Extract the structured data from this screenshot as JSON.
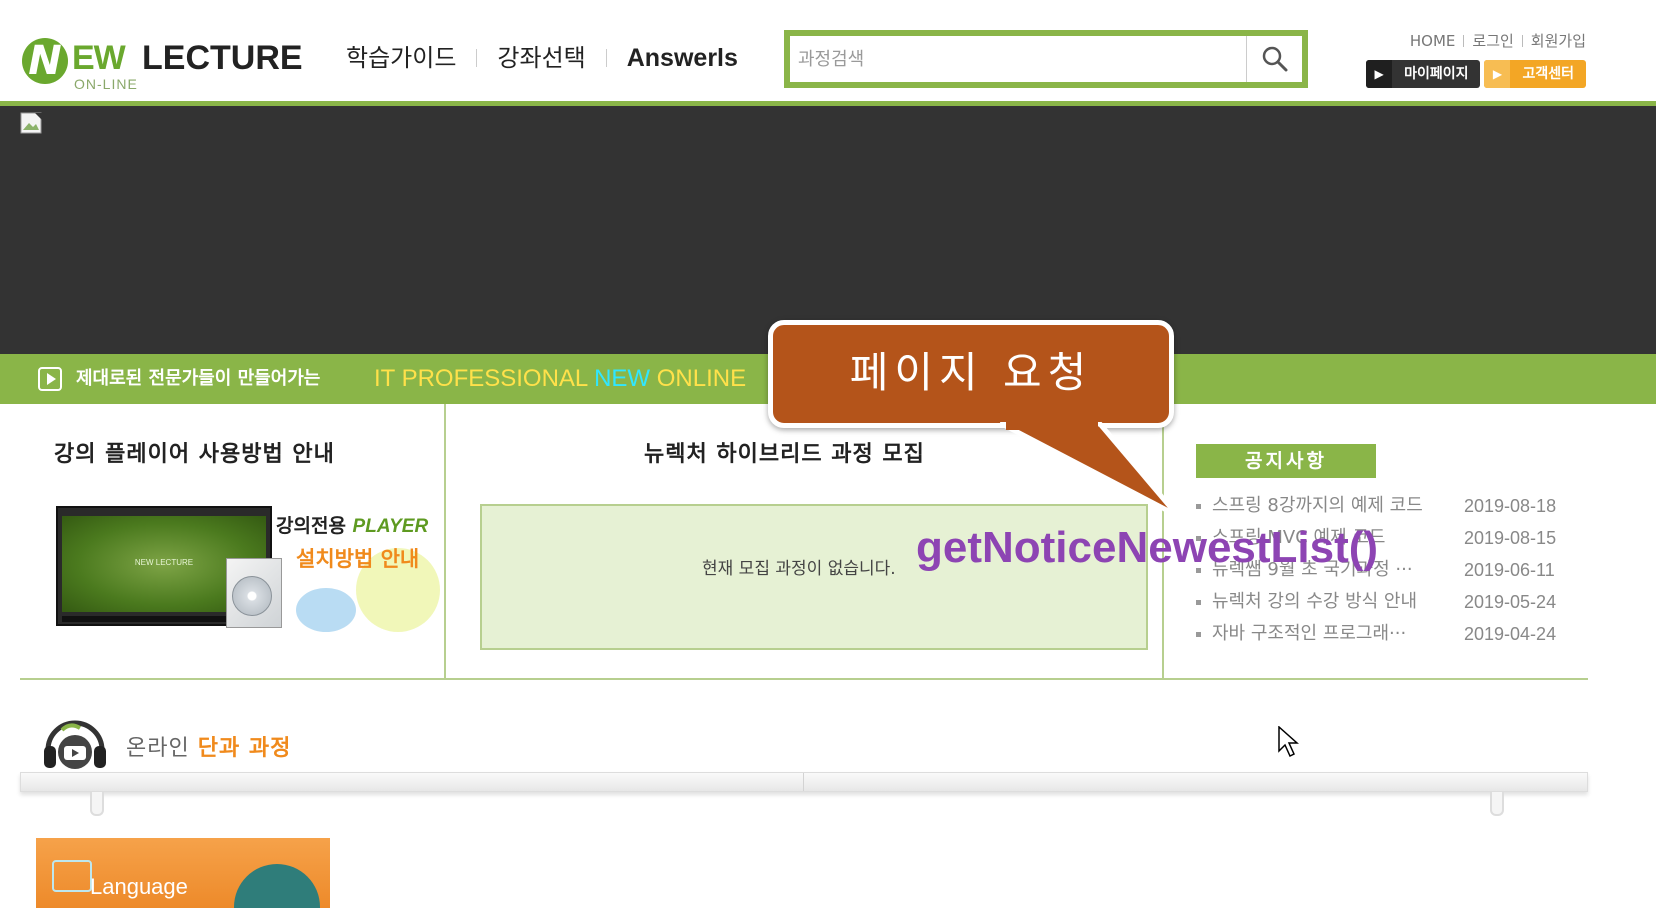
{
  "header": {
    "logo": {
      "initial": "N",
      "text_ew": "EW",
      "text_lecture": "LECTURE",
      "sub": "ON-LINE"
    },
    "nav": [
      {
        "label": "학습가이드"
      },
      {
        "label": "강좌선택"
      },
      {
        "label": "Answerls"
      }
    ],
    "search": {
      "placeholder": "과정검색"
    },
    "util_links": [
      {
        "label": "HOME"
      },
      {
        "label": "로그인"
      },
      {
        "label": "회원가입"
      }
    ],
    "mypage_label": "마이페이지",
    "customer_label": "고객센터"
  },
  "strip": {
    "kor_text": "제대로된 전문가들이 만들어가는",
    "eng_text_a": "IT PROFESSIONAL ",
    "eng_text_b": "NEW",
    "eng_text_c": " ONLINE"
  },
  "player_guide": {
    "title": "강의 플레이어 사용방법 안내",
    "screen_logo": "NEW LECTURE",
    "line1_a": "강의전용 ",
    "line1_b": "PLAYER",
    "line2": "설치방법 안내"
  },
  "recruit": {
    "title": "뉴렉처 하이브리드 과정 모집",
    "empty_message": "현재 모집 과정이 없습니다."
  },
  "notice": {
    "tab_label": "공지사항",
    "items": [
      {
        "title": "스프링 8강까지의 예제 코드",
        "date": "2019-08-18"
      },
      {
        "title": "스프링 MVC 예제 코드",
        "date": "2019-08-15"
      },
      {
        "title": "뉴렉쌤 9월 초 국기과정 ···",
        "date": "2019-06-11"
      },
      {
        "title": "뉴렉처 강의 수강 방식 안내",
        "date": "2019-05-24"
      },
      {
        "title": "자바 구조적인 프로그래···",
        "date": "2019-04-24"
      }
    ]
  },
  "online": {
    "title_a": "온라인 ",
    "title_b": "단과 과정",
    "course_card_label": "Language"
  },
  "overlay": {
    "callout_text": "페이지 요청",
    "function_label": "getNoticeNewestList()"
  },
  "colors": {
    "brand_green": "#8ab548",
    "accent_orange": "#f08a1c",
    "callout_brown": "#b4541a",
    "annotation_purple": "#8d44b3"
  }
}
